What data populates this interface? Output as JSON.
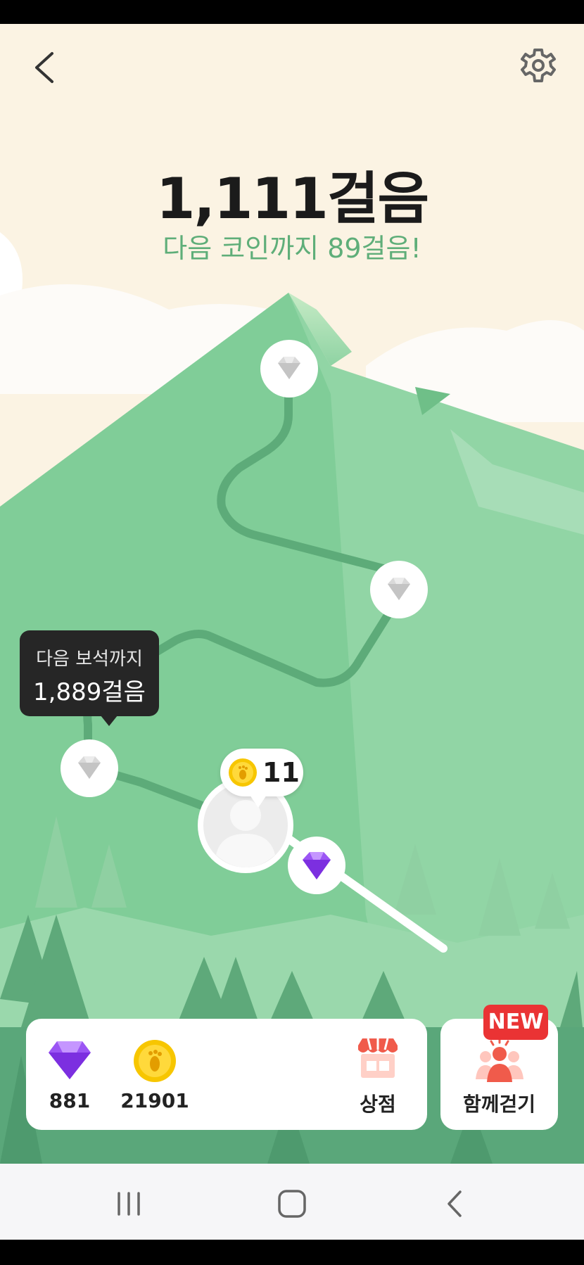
{
  "header": {
    "back_icon": "chevron-left-icon",
    "settings_icon": "gear-icon",
    "steps_title": "1,111걸음",
    "next_coin_text": "다음 코인까지 89걸음!"
  },
  "map": {
    "next_gem_tooltip": {
      "line1": "다음 보석까지",
      "line2": "1,889걸음"
    },
    "avatar_coin_count": "11"
  },
  "bottom_panel": {
    "gem_count": "881",
    "coin_count": "21901",
    "shop_label": "상점",
    "walk_together_label": "함께걷기",
    "new_badge": "NEW"
  },
  "nav_bar": {
    "recent_icon": "recent-apps-icon",
    "home_icon": "home-icon",
    "back_icon": "back-icon"
  },
  "colors": {
    "sky": "#fbf3e3",
    "mountain": "#7fcc98",
    "path": "#5dab79",
    "accent_purple": "#8a3ff0",
    "coin_yellow": "#f7c600",
    "new_red": "#ea3334"
  }
}
